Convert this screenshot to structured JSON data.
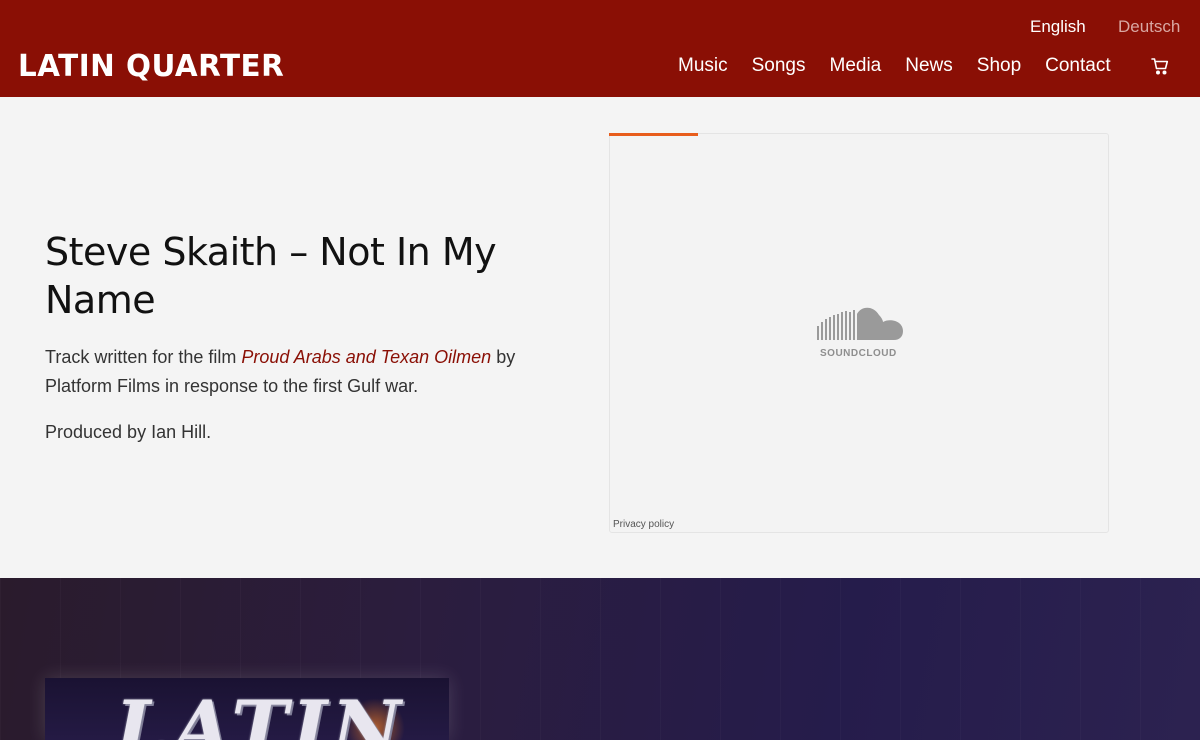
{
  "header": {
    "logo": "LATIN QUARTER",
    "languages": {
      "english": "English",
      "deutsch": "Deutsch"
    },
    "nav": [
      "Music",
      "Songs",
      "Media",
      "News",
      "Shop",
      "Contact"
    ],
    "cart_icon": "cart-icon"
  },
  "track": {
    "title": "Steve Skaith – Not In My Name",
    "desc_before": "Track written for the film ",
    "film": "Proud Arabs and Texan Oilmen",
    "desc_after": " by Platform Films in response to the first Gulf war.",
    "produced": "Produced by Ian Hill."
  },
  "embed": {
    "provider": "SOUNDCLOUD",
    "privacy": "Privacy policy",
    "accent": "#e85d1c"
  },
  "album": {
    "text": "LATIN"
  },
  "colors": {
    "brand": "#8a0f05",
    "link": "#8a0f05"
  }
}
